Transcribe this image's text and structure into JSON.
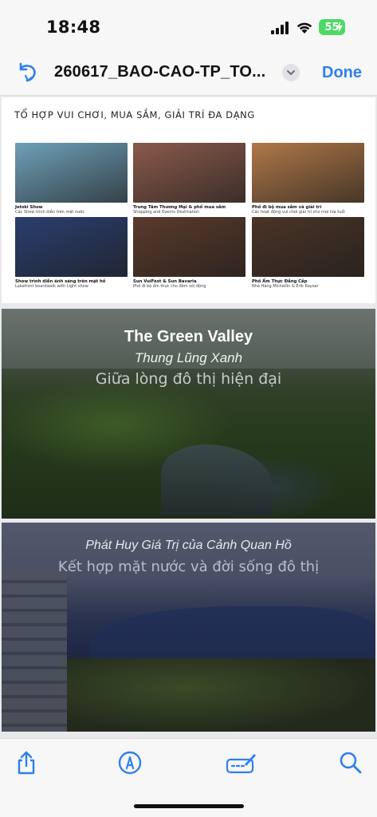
{
  "status_bar": {
    "time": "18:48",
    "battery": "55"
  },
  "nav": {
    "title": "260617_BAO-CAO-TP_TO...",
    "done_label": "Done"
  },
  "page1": {
    "title": "TỔ HỢP VUI CHƠI, MUA SẮM, GIẢI TRÍ ĐA DẠNG",
    "tiles": [
      {
        "caption": "Jetski Show",
        "sub": "Các Show trình diễn trên mặt nước",
        "color": "#6fa0b8"
      },
      {
        "caption": "Trung Tâm Thương Mại & phố mua sắm",
        "sub": "Shopping and Events Destination",
        "color": "#8a5a4a"
      },
      {
        "caption": "Phố đi bộ mua sắm và giải trí",
        "sub": "Các hoạt động vui chơi giải trí cho mọi lứa tuổi",
        "color": "#b07848"
      },
      {
        "caption": "Show trình diễn ánh sáng trên mặt hồ",
        "sub": "Lakefront boardwalk with Light show",
        "color": "#2a3e6e"
      },
      {
        "caption": "Sun VuiFest  & Sun Bavaria",
        "sub": "Phố đi bộ ẩm thực cho đêm sôi động",
        "color": "#5a3a2a"
      },
      {
        "caption": "Phố Ẩm Thực Đẳng Cấp",
        "sub": "Nhà Hàng Michellin & Erik Kayser",
        "color": "#4a3426"
      }
    ]
  },
  "page2": {
    "title": "The Green Valley",
    "subtitle": "Thung Lũng Xanh",
    "tagline": "Giữa lòng đô thị hiện đại"
  },
  "page3": {
    "subtitle": "Phát Huy Giá Trị của Cảnh Quan Hồ",
    "tagline": "Kết hợp mặt nước và đời sống đô thị"
  },
  "toolbar": {
    "icons": [
      "share-icon",
      "markup-icon",
      "signature-icon",
      "search-icon"
    ]
  },
  "colors": {
    "accent": "#2f7ff0",
    "battery": "#4cd964"
  }
}
